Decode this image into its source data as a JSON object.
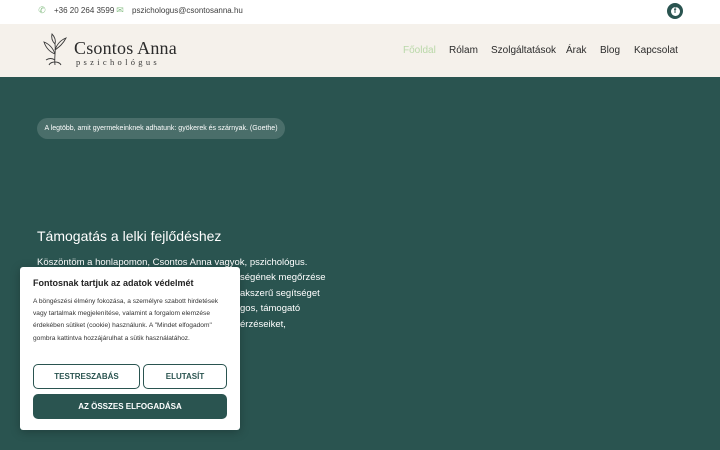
{
  "topbar": {
    "phone": "+36 20 264 3599",
    "email": "pszichologus@csontosanna.hu",
    "phone_icon": "phone-icon",
    "email_icon": "email-icon",
    "social_icon": "facebook-icon"
  },
  "header": {
    "brand_name": "Csontos Anna",
    "brand_sub": "pszichológus",
    "nav": [
      "Főoldal",
      "Rólam",
      "Szolgáltatások",
      "Árak",
      "Blog",
      "Kapcsolat"
    ],
    "active_nav": "Főoldal"
  },
  "hero": {
    "quote": "A legtöbb, amit gyermekeinknek adhatunk: gyökerek és szárnyak. (Goethe)",
    "title": "Támogatás a lelki fejlődéshez",
    "lines": [
      "Köszöntöm a honlapomon, Csontos Anna vagyok, pszichológus.",
      "ségének megőrzése",
      "akszerű segítséget",
      "gos, támogató",
      "érzéseiket,"
    ]
  },
  "cookie": {
    "title": "Fontosnak tartjuk az adatok védelmét",
    "text": "A böngészési élmény fokozása, a személyre szabott hirdetések vagy tartalmak megjelenítése, valamint a forgalom elemzése érdekében sütiket (cookie) használunk. A \"Mindet elfogadom\" gombra kattintva hozzájárulhat a sütik használatához.",
    "customize_label": "TESTRESZABÁS",
    "reject_label": "ELUTASÍT",
    "accept_label": "AZ ÖSSZES ELFOGADÁSA"
  },
  "colors": {
    "primary": "#2a5450",
    "header_bg": "#f5f1eb",
    "active_nav": "#b9d8a8",
    "icon_green": "#8cc08a"
  }
}
